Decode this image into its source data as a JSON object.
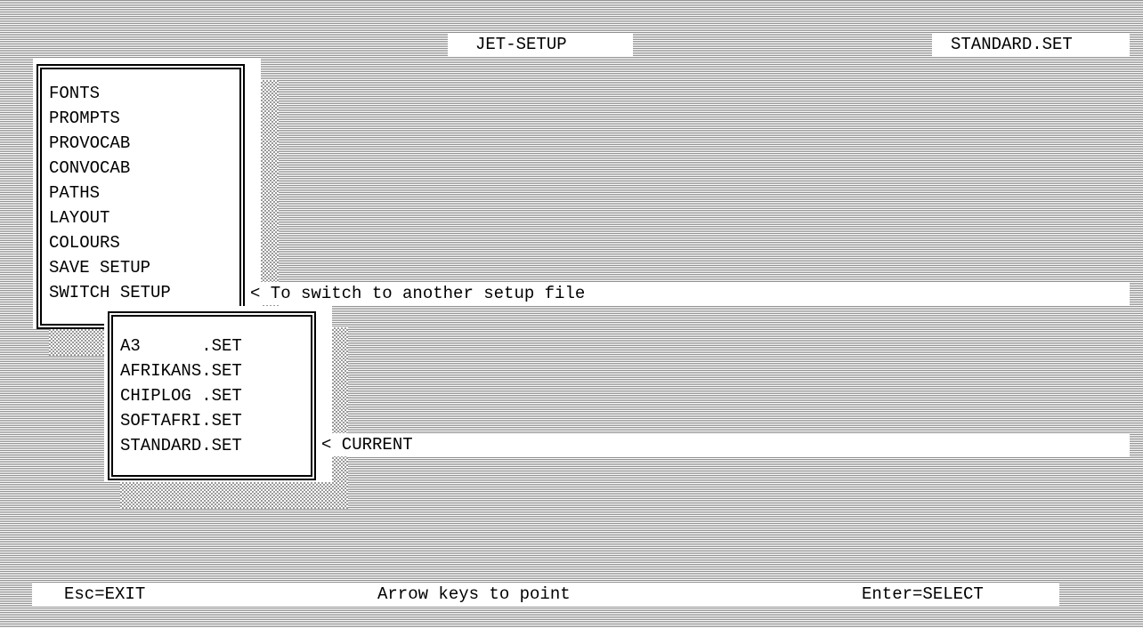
{
  "header": {
    "app_title": "JET-SETUP",
    "current_file": "STANDARD.SET"
  },
  "main_menu": {
    "items": [
      {
        "label": "FONTS"
      },
      {
        "label": "PROMPTS"
      },
      {
        "label": "PROVOCAB"
      },
      {
        "label": "CONVOCAB"
      },
      {
        "label": "PATHS"
      },
      {
        "label": "LAYOUT"
      },
      {
        "label": "COLOURS"
      },
      {
        "label": "SAVE SETUP"
      },
      {
        "label": "SWITCH SETUP"
      }
    ],
    "selected_hint": "< To switch to another setup file"
  },
  "setup_files": {
    "items": [
      {
        "label": "A3      .SET"
      },
      {
        "label": "AFRIKANS.SET"
      },
      {
        "label": "CHIPLOG .SET"
      },
      {
        "label": "SOFTAFRI.SET"
      },
      {
        "label": "STANDARD.SET"
      }
    ],
    "current_hint": "< CURRENT"
  },
  "footer": {
    "exit": "Esc=EXIT",
    "navigate": "Arrow keys to point",
    "select": "Enter=SELECT"
  }
}
